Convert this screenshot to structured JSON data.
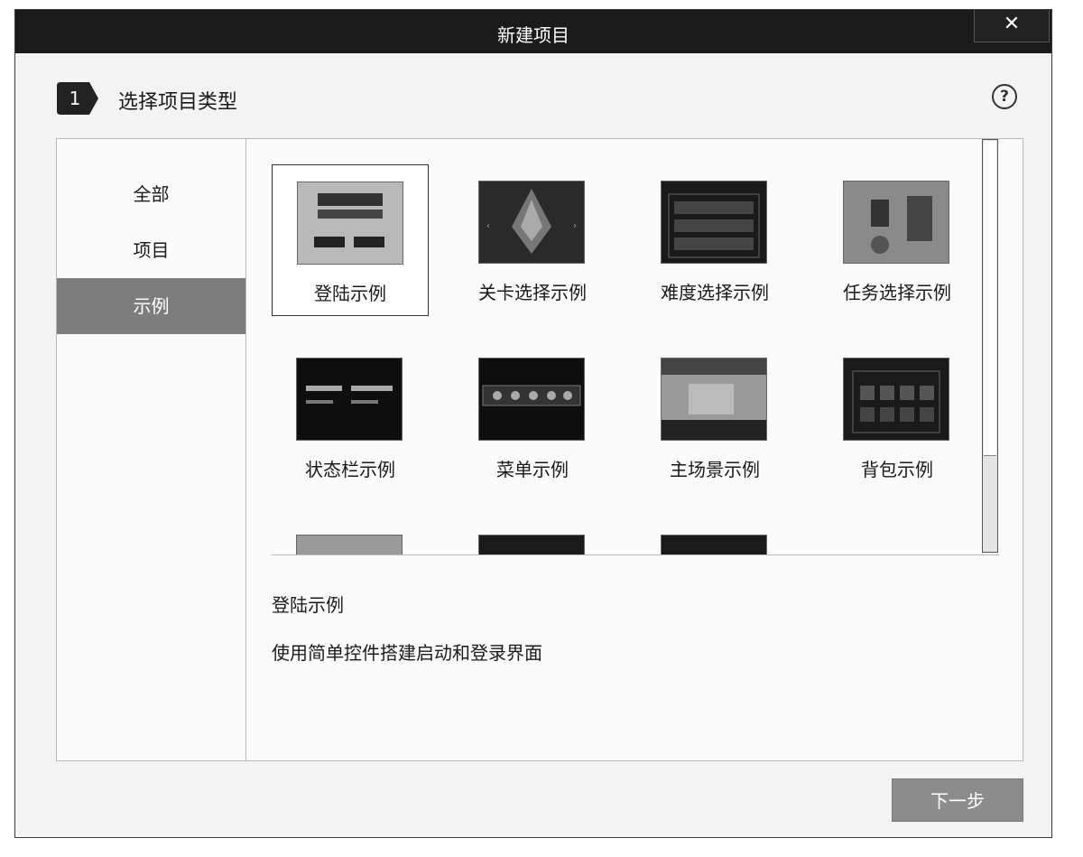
{
  "window": {
    "title": "新建项目",
    "close_glyph": "✕"
  },
  "step": {
    "number": "1",
    "title": "选择项目类型",
    "help_glyph": "?"
  },
  "sidebar": {
    "items": [
      {
        "label": "全部",
        "selected": false
      },
      {
        "label": "项目",
        "selected": false
      },
      {
        "label": "示例",
        "selected": true
      }
    ]
  },
  "templates": [
    {
      "label": "登陆示例",
      "selected": true
    },
    {
      "label": "关卡选择示例",
      "selected": false
    },
    {
      "label": "难度选择示例",
      "selected": false
    },
    {
      "label": "任务选择示例",
      "selected": false
    },
    {
      "label": "状态栏示例",
      "selected": false
    },
    {
      "label": "菜单示例",
      "selected": false
    },
    {
      "label": "主场景示例",
      "selected": false
    },
    {
      "label": "背包示例",
      "selected": false
    }
  ],
  "description": {
    "title": "登陆示例",
    "text": "使用简单控件搭建启动和登录界面"
  },
  "footer": {
    "next_label": "下一步"
  },
  "colors": {
    "titlebar": "#1b1b1b",
    "sidebar_active": "#7d7d7d",
    "next_button": "#8c8c8c"
  }
}
